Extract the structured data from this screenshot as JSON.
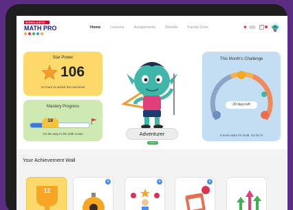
{
  "header": {
    "brand": "SCHOLASTIC",
    "product": "MATH PRO",
    "nav": [
      "Home",
      "Lessons",
      "Assignments",
      "Results",
      "Family Zone"
    ],
    "active_nav": "Home"
  },
  "star_power": {
    "title": "Star Power",
    "value": "106",
    "subtitle": "12 more to unlock the next level"
  },
  "mastery": {
    "title": "Mastery Progress",
    "value": "19",
    "progress_fraction": 0.35,
    "subtitle": "On the way to the 20th crown"
  },
  "character": {
    "name": "Adventurer",
    "level_label": "Level 4"
  },
  "challenge": {
    "title": "This Month's Challenge",
    "days_left": "20 days left",
    "subtitle": "5 more stars for Gold. Go for it!"
  },
  "achievements": {
    "title": "Your Achievement Wall",
    "tiles": [
      {
        "name": "trophy",
        "icon": "trophy-icon",
        "label": "12",
        "bg": "#fdd86a"
      },
      {
        "name": "stopwatch",
        "icon": "stopwatch-icon",
        "count": "4",
        "bg": "#ffffff"
      },
      {
        "name": "star-kid",
        "icon": "celebrate-icon",
        "count": "4",
        "bg": "#ffffff"
      },
      {
        "name": "calendar",
        "icon": "calendar-icon",
        "count": "4",
        "bg": "#ffffff"
      },
      {
        "name": "arrows",
        "icon": "growth-arrows-icon",
        "bg": "#ffffff"
      }
    ]
  },
  "colors": {
    "accent_red": "#c8102e",
    "star_yellow": "#fdd86a",
    "mastery_green": "#cfe9b3",
    "challenge_blue": "#c3def3",
    "progress_blue": "#3d7ad6",
    "level_green": "#3bb44a"
  }
}
